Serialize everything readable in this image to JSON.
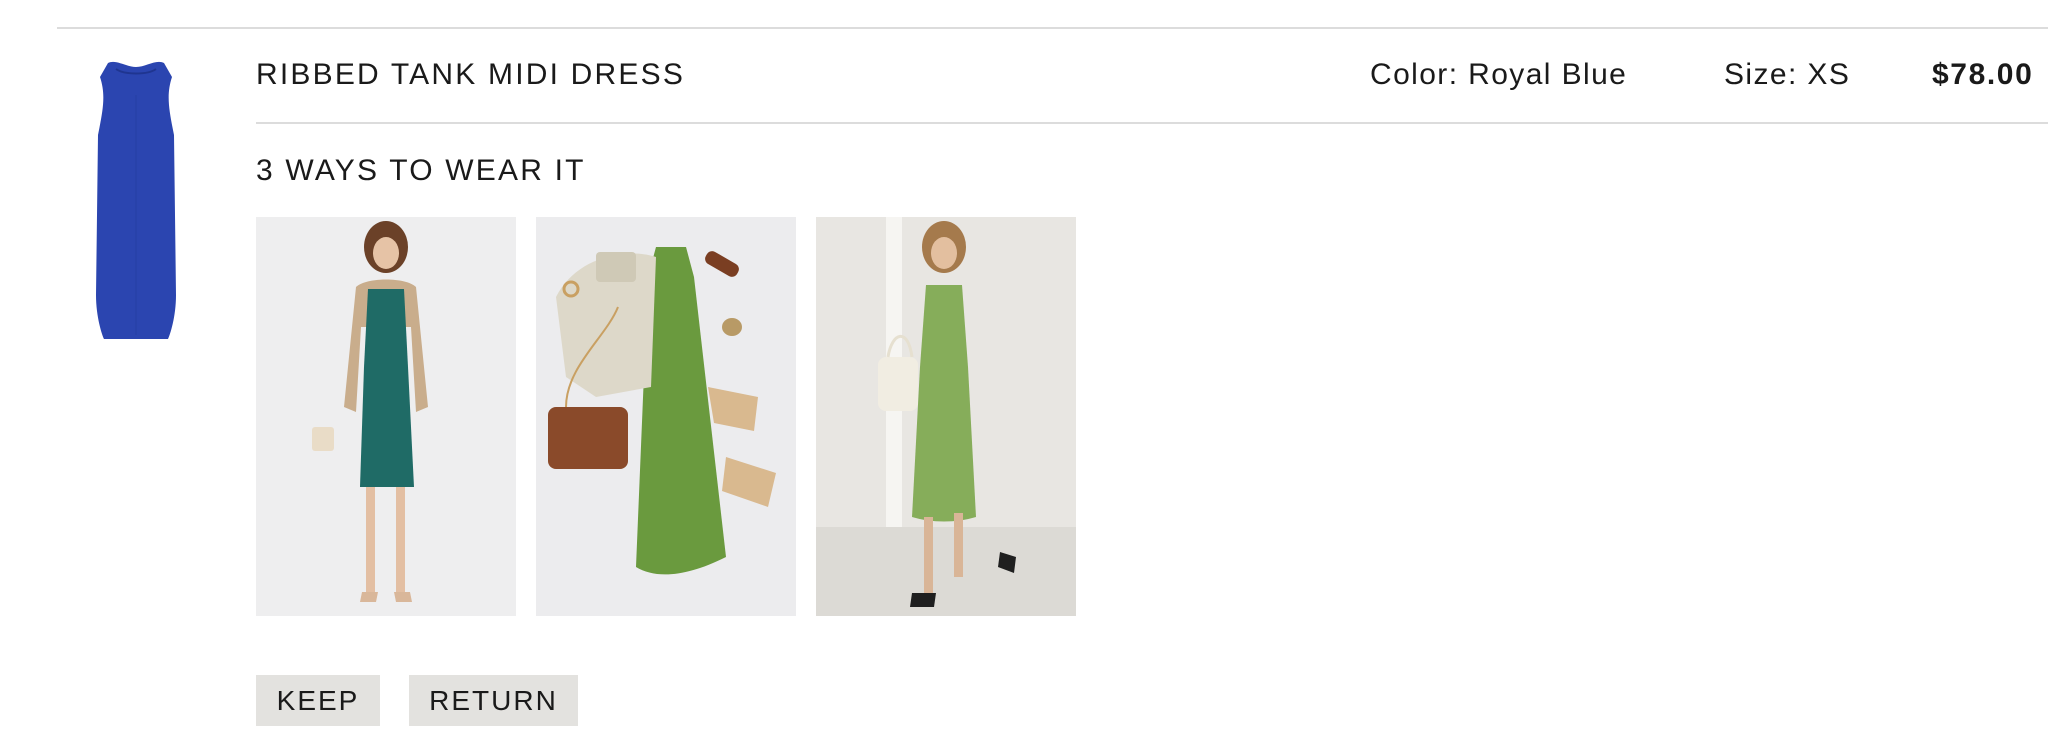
{
  "item": {
    "thumbnail_icon": "royal-blue-tank-dress-image",
    "name": "RIBBED TANK MIDI DRESS",
    "color": "Color: Royal Blue",
    "size": "Size: XS",
    "price": "$78.00",
    "swatch_color": "#2b45b0"
  },
  "styling": {
    "heading": "3 WAYS TO WEAR IT",
    "looks": [
      {
        "image": "model-teal-dress-cardigan-photo",
        "dress_color": "#1f6b66"
      },
      {
        "image": "flatlay-green-dress-jacket-bag-photo",
        "dress_color": "#6a9a3e"
      },
      {
        "image": "model-green-dress-tote-photo",
        "dress_color": "#86ad5a"
      }
    ]
  },
  "actions": {
    "keep_label": "KEEP",
    "return_label": "RETURN"
  }
}
